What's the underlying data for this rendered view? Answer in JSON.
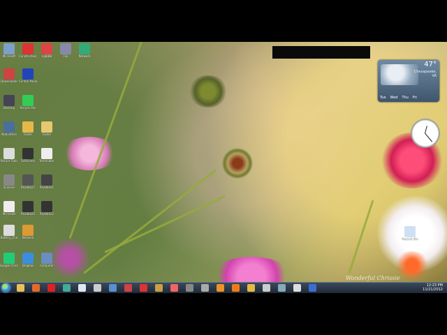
{
  "weather": {
    "temperature": "47°",
    "place": "Chesapeake, VA",
    "days": [
      "Tue",
      "Wed",
      "Thu",
      "Fri"
    ]
  },
  "taskbar": {
    "time": "12:23 PM",
    "date": "11/21/2012",
    "icons": [
      "explorer-icon",
      "firefox-icon",
      "opera-icon",
      "chrome-icon",
      "document-icon",
      "alien-icon",
      "download-icon",
      "media-icon",
      "shield-icon",
      "pencil-icon",
      "picasa-icon",
      "flag-icon",
      "drive-icon",
      "orange-circle-icon",
      "vlc-icon",
      "folder-icon",
      "pin-icon",
      "network-icon",
      "speaker-icon",
      "monitor-icon"
    ]
  },
  "signature": "Wonderful Chrissie",
  "desktop_icons": [
    {
      "icon": "monitor-icon",
      "color": "#7da0c8",
      "label": "Microsoft"
    },
    {
      "icon": "puzzle-icon",
      "color": "#d33",
      "label": "Construction Battle"
    },
    {
      "icon": "tools-icon",
      "color": "#d44",
      "label": "nglBBB"
    },
    {
      "icon": "terminal-icon",
      "color": "#88a",
      "label": "File"
    },
    {
      "icon": "network-icon",
      "color": "#3a7",
      "label": "Network"
    },
    {
      "icon": "anime-icon",
      "color": "#c44",
      "label": "Downloader"
    },
    {
      "icon": "globe-icon",
      "color": "#24b",
      "label": "Control Panel"
    },
    {
      "icon": "people-icon",
      "color": "#445",
      "label": "Desktop"
    },
    {
      "icon": "recycle-icon",
      "color": "#3c5",
      "label": "Recycle Bin"
    },
    {
      "icon": "window-icon",
      "color": "#4a6f9c",
      "label": "NoticeFiles"
    },
    {
      "icon": "folder-icon",
      "color": "#e5b84a",
      "label": "Folder"
    },
    {
      "icon": "folder-icon",
      "color": "#e5c870",
      "label": "Folder"
    },
    {
      "icon": "camera-icon",
      "color": "#ddd",
      "label": "Picture Tools"
    },
    {
      "icon": "monitor-icon",
      "color": "#333",
      "label": "FullScreen"
    },
    {
      "icon": "skull-icon",
      "color": "#eee",
      "label": "Terminator"
    },
    {
      "icon": "scanner-icon",
      "color": "#888",
      "label": "Scanner"
    },
    {
      "icon": "photo-icon",
      "color": "#555",
      "label": "P4280027"
    },
    {
      "icon": "photo-icon",
      "color": "#444",
      "label": "P4280031"
    },
    {
      "icon": "document-icon",
      "color": "#eee",
      "label": "Microsoft"
    },
    {
      "icon": "photo-icon",
      "color": "#333",
      "label": "P4280025"
    },
    {
      "icon": "photo-icon",
      "color": "#333",
      "label": "P4280022"
    },
    {
      "icon": "document-icon",
      "color": "#ddd",
      "label": "Battery_Che"
    },
    {
      "icon": "tool-icon",
      "color": "#d93",
      "label": "Network"
    },
    {
      "icon": "chrome-icon",
      "color": "#2c7",
      "label": "Google Chrome"
    },
    {
      "icon": "dropbox-icon",
      "color": "#3a8ee0",
      "label": "Dropbox"
    },
    {
      "icon": "computer-icon",
      "color": "#6a8ec0",
      "label": "Computer"
    },
    {
      "icon": "recycle-icon",
      "color": "#cfe0f5",
      "label": "Recycle Bin"
    }
  ]
}
